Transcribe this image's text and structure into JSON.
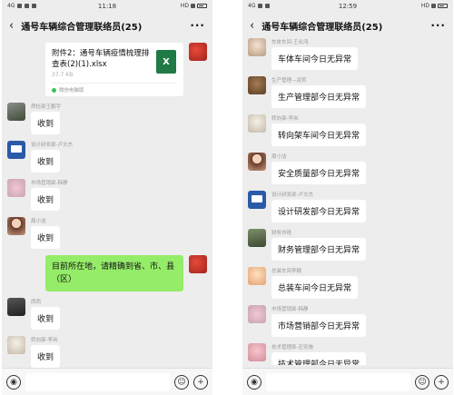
{
  "statusbar": {
    "left_time": "11:18",
    "right_time": "12:59",
    "network": "4G",
    "hd": "HD"
  },
  "header": {
    "back_icon": "‹",
    "title": "通号车辆综合管理联络员(25)",
    "more_icon": "···"
  },
  "left_chat": {
    "file": {
      "name": "附件2：通号车辆疫情梳理排查表(2)(1).xlsx",
      "size": "37.7 KB",
      "source": "微信电脑版",
      "icon_letter": "X"
    },
    "messages": [
      {
        "sender": "质检部王鹏宇",
        "text": "收到"
      },
      {
        "sender": "设计研发部-卢文杰",
        "text": "收到"
      },
      {
        "sender": "市场营销部-韩静",
        "text": "收到"
      },
      {
        "sender": "周小洁",
        "text": "收到"
      },
      {
        "self": true,
        "text": "目前所在地，请精确到省、市、县（区）"
      },
      {
        "sender": "西西",
        "text": "收到"
      },
      {
        "sender": "转向架-李岚",
        "text": "收到"
      }
    ]
  },
  "right_chat": {
    "messages": [
      {
        "sender": "车体车间-王业鸿",
        "text": "车体车间今日无异常"
      },
      {
        "sender": "生产管理—凌莉",
        "text": "生产管理部今日无异常"
      },
      {
        "sender": "转向架-李岚",
        "text": "转向架车间今日无异常"
      },
      {
        "sender": "周小洁",
        "text": "安全质量部今日无异常"
      },
      {
        "sender": "设计研发部-卢文杰",
        "text": "设计研发部今日无异常"
      },
      {
        "sender": "财务刘艳",
        "text": "财务管理部今日无异常"
      },
      {
        "sender": "总装车间李楠",
        "text": "总装车间今日无异常"
      },
      {
        "sender": "市场营销部-韩静",
        "text": "市场营销部今日无异常"
      },
      {
        "sender": "技术管理部-应安施",
        "text": "技术管理部今日无异常"
      }
    ]
  },
  "inputbar": {
    "voice_icon": "◉",
    "emoji_icon": "☺",
    "plus_icon": "+"
  }
}
